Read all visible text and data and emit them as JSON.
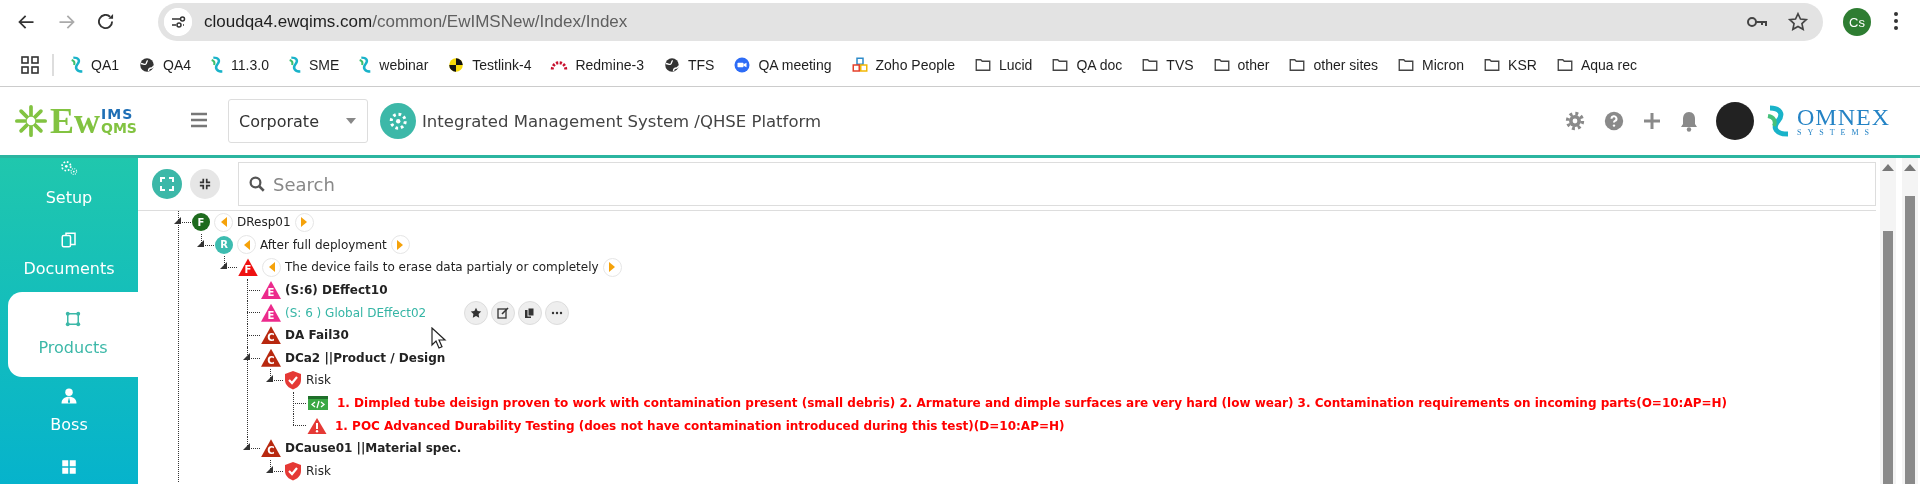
{
  "browser": {
    "forward_disabled": true,
    "url_host": "cloudqa4.ewqims.com",
    "url_path": "/common/EwIMSNew/Index/Index",
    "profile": "Cs",
    "bookmarks": [
      {
        "label": "QA1",
        "kind": "ewqims"
      },
      {
        "label": "QA4",
        "kind": "globe"
      },
      {
        "label": "11.3.0",
        "kind": "ewqims"
      },
      {
        "label": "SME",
        "kind": "ewqims"
      },
      {
        "label": "webinar",
        "kind": "ewqims"
      },
      {
        "label": "Testlink-4",
        "kind": "testlink"
      },
      {
        "label": "Redmine-3",
        "kind": "redmine"
      },
      {
        "label": "TFS",
        "kind": "globe"
      },
      {
        "label": "QA meeting",
        "kind": "zoom"
      },
      {
        "label": "Zoho People",
        "kind": "zoho"
      },
      {
        "label": "Lucid",
        "kind": "folder"
      },
      {
        "label": "QA doc",
        "kind": "folder"
      },
      {
        "label": "TVS",
        "kind": "folder"
      },
      {
        "label": "other",
        "kind": "folder"
      },
      {
        "label": "other sites",
        "kind": "folder"
      },
      {
        "label": "Micron",
        "kind": "folder"
      },
      {
        "label": "KSR",
        "kind": "folder"
      },
      {
        "label": "Aqua rec",
        "kind": "folder"
      }
    ]
  },
  "header": {
    "logo": {
      "main": "Ew",
      "top": "IMS",
      "bottom": "QMS"
    },
    "site": "Corporate",
    "title": "Integrated Management System /QHSE Platform",
    "brand": {
      "name": "OMNEX",
      "tagline": "SYSTEMS"
    }
  },
  "sidebar": {
    "items": [
      {
        "label": "Setup",
        "kind": "setup",
        "selected": false
      },
      {
        "label": "Documents",
        "kind": "documents",
        "selected": false
      },
      {
        "label": "Products",
        "kind": "products",
        "selected": true
      },
      {
        "label": "Boss",
        "kind": "boss",
        "selected": false
      },
      {
        "kind": "grid",
        "selected": false
      }
    ]
  },
  "search": {
    "placeholder": "Search"
  },
  "tree": [
    {
      "badge": "F",
      "kind": "circle",
      "color": "#1e6b1e",
      "label": "DResp01",
      "bold": false,
      "alert": false,
      "arrows": true,
      "hovered": false,
      "expanded": true,
      "children": [
        {
          "badge": "R",
          "kind": "circle",
          "color": "#3dbcb0",
          "label": "After full deployment",
          "bold": false,
          "alert": false,
          "arrows": true,
          "hovered": false,
          "expanded": true,
          "children": [
            {
              "badge": "F",
              "kind": "triangle",
              "color": "#ee1111",
              "label": "The device fails to erase data partialy or completely",
              "bold": false,
              "alert": false,
              "arrows": true,
              "hovered": false,
              "expanded": true,
              "children": [
                {
                  "badge": "E",
                  "kind": "triangle",
                  "color": "#ec2a8c",
                  "label": "(S:6) DEffect10",
                  "bold": true,
                  "alert": false,
                  "arrows": false,
                  "hovered": false
                },
                {
                  "badge": "E",
                  "kind": "triangle",
                  "color": "#ec2a8c",
                  "label": "(S: 6 ) Global DEffect02",
                  "bold": false,
                  "alert": false,
                  "arrows": false,
                  "hovered": true
                },
                {
                  "badge": "C",
                  "kind": "triangle",
                  "color": "#b8280f",
                  "label": "DA Fail30",
                  "bold": true,
                  "alert": false,
                  "arrows": false,
                  "hovered": false
                },
                {
                  "badge": "C",
                  "kind": "triangle",
                  "color": "#b8280f",
                  "label": "DCa2 ||Product / Design",
                  "bold": true,
                  "alert": false,
                  "arrows": false,
                  "hovered": false,
                  "expanded": true,
                  "children": [
                    {
                      "kind": "shield",
                      "color": "#e53935",
                      "label": "Risk",
                      "bold": false,
                      "alert": false,
                      "arrows": false,
                      "hovered": false,
                      "expanded": true,
                      "children": [
                        {
                          "kind": "code",
                          "color": "#3aa845",
                          "label": "1. Dimpled tube deisign proven to work with contamination present (small debris) 2. Armature and dimple surfaces are very hard (low wear) 3. Contamination requirements on incoming parts(O=10:AP=H)",
                          "bold": true,
                          "alert": true,
                          "arrows": false,
                          "hovered": false
                        },
                        {
                          "kind": "warning",
                          "color": "#e53935",
                          "label": "1. POC Advanced Durability Testing (does not have contamination introduced during this test)(D=10:AP=H)",
                          "bold": true,
                          "alert": true,
                          "arrows": false,
                          "hovered": false
                        }
                      ]
                    }
                  ]
                },
                {
                  "badge": "C",
                  "kind": "triangle",
                  "color": "#b8280f",
                  "label": "DCause01 ||Material spec.",
                  "bold": true,
                  "alert": false,
                  "arrows": false,
                  "hovered": false,
                  "expanded": true,
                  "children": [
                    {
                      "kind": "shield",
                      "color": "#e53935",
                      "label": "Risk",
                      "bold": false,
                      "alert": false,
                      "arrows": false,
                      "hovered": false,
                      "expanded": true
                    }
                  ]
                }
              ]
            }
          ]
        }
      ]
    }
  ]
}
